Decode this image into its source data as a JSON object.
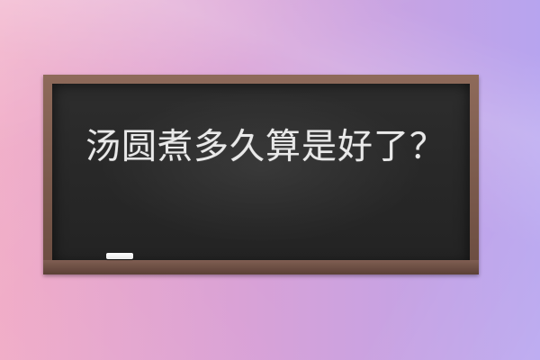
{
  "title": "汤圆煮多久算是好了？",
  "colors": {
    "board": "#2b2b2b",
    "frame": "#7a5a4d",
    "text": "#e9e9e9",
    "bg_left": "#f0a9c5",
    "bg_right": "#b7a4ef"
  }
}
